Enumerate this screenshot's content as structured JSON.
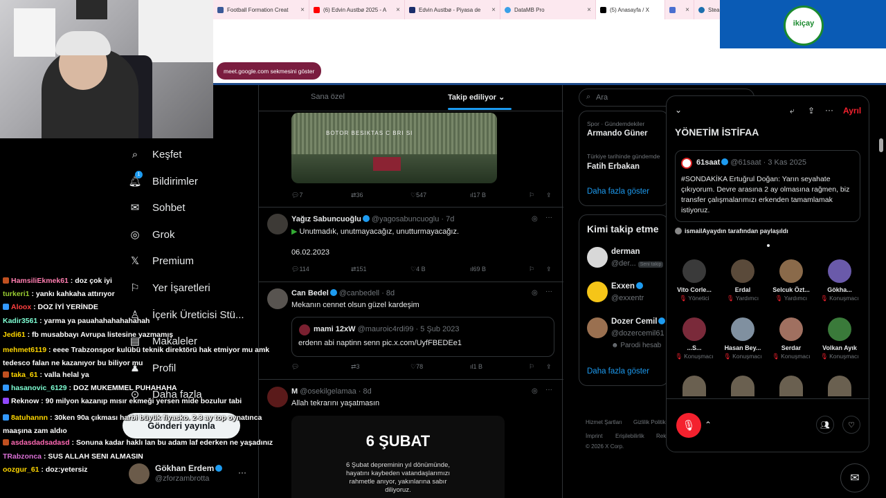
{
  "browser": {
    "tabs": [
      {
        "label": "Football Formation Creat",
        "color": "#3b5998"
      },
      {
        "label": "(6) Edvin Austbø 2025 - A",
        "color": "#ff0000"
      },
      {
        "label": "Edvin Austbø - Piyasa de",
        "color": "#1a2d6b"
      },
      {
        "label": "DataMB Pro",
        "color": "#3aa0e8"
      },
      {
        "label": "(5) Anasayfa / X",
        "color": "#000000"
      },
      {
        "label": "",
        "color": "#4a6fd0"
      },
      {
        "label": "Steam",
        "color": "#1b6fae"
      }
    ],
    "notification_pill": "meet.google.com sekmesini göster"
  },
  "sponsor": {
    "logo_text": "ikiçay"
  },
  "nav": {
    "items": [
      {
        "icon": "search-icon",
        "label": "Keşfet"
      },
      {
        "icon": "bell-icon",
        "label": "Bildirimler"
      },
      {
        "icon": "mail-icon",
        "label": "Sohbet"
      },
      {
        "icon": "grok-icon",
        "label": "Grok"
      },
      {
        "icon": "x-logo-icon",
        "label": "Premium"
      },
      {
        "icon": "bookmark-icon",
        "label": "Yer İşaretleri"
      },
      {
        "icon": "creator-icon",
        "label": "İçerik Üreticisi Stü..."
      },
      {
        "icon": "lists-icon",
        "label": "Makaleler"
      },
      {
        "icon": "person-icon",
        "label": "Profil"
      },
      {
        "icon": "more-icon",
        "label": "Daha fazla"
      }
    ],
    "notification_badge": "1",
    "post_button": "Gönderi yayınla",
    "account": {
      "name": "Gökhan Erdem",
      "handle": "@zforzambrotta"
    }
  },
  "feed": {
    "tabs": {
      "for_you": "Sana özel",
      "following": "Takip ediliyor"
    },
    "tweet0": {
      "media_text": "BOTOR BESIKTAS C BRI SI",
      "replies": "7",
      "retweets": "36",
      "likes": "547",
      "views": "17 B"
    },
    "tweet1": {
      "name": "Yağız Sabuncuoğlu",
      "handle": "@yagosabuncuoglu",
      "time": "7d",
      "text": "Unutmadık, unutmayacağız, unutturmayacağız.",
      "text2": "06.02.2023",
      "replies": "114",
      "retweets": "151",
      "likes": "4 B",
      "views": "69 B"
    },
    "tweet2": {
      "name": "Can Bedel",
      "handle": "@canbedell",
      "time": "8d",
      "text": "Mekanın cennet olsun güzel kardeşim",
      "quote_name": "mami 12xW",
      "quote_handle": "@mauroic4rdi99",
      "quote_time": "5 Şub 2023",
      "quote_text": "erdenn abi naptinn senn pic.x.com/UyfFBEDEe1",
      "replies": "",
      "retweets": "3",
      "likes": "78",
      "views": "1 B"
    },
    "tweet3": {
      "name": "M",
      "handle": "@osekilgelamaa",
      "time": "8d",
      "text": "Allah tekrarını yaşatmasın",
      "card_title": "6 ŞUBAT",
      "card_text": "6 Şubat depreminin yıl dönümünde,\nhayatını kaybeden vatandaşlarımızı\nrahmetle anıyor, yakınlarına sabır\ndiliyoruz."
    }
  },
  "right": {
    "search_placeholder": "Ara",
    "trends": [
      {
        "context": "Spor · Gündemdekiler",
        "name": "Armando Güner"
      },
      {
        "context": "Türkiye tarihinde gündemde",
        "name": "Fatih Erbakan"
      }
    ],
    "trends_more": "Daha fazla göster",
    "who_title": "Kimi takip etme",
    "who": [
      {
        "name": "derman",
        "handle": "@der...",
        "badge": "Seni takip"
      },
      {
        "name": "Exxen",
        "handle": "@exxentr",
        "badge": ""
      },
      {
        "name": "Dozer Cemil",
        "handle": "@dozercemil61",
        "badge": "Parodi hesab"
      }
    ],
    "who_more": "Daha fazla göster",
    "footer": [
      "Hizmet Şartları",
      "Gizlilik Politik",
      "İmprint",
      "Erişilebilirlik",
      "Rek",
      "© 2026 X Corp."
    ]
  },
  "space": {
    "leave": "Ayrıl",
    "title": "YÖNETİM İSTİFAA",
    "pinned": {
      "name": "61saat",
      "handle": "@61saat",
      "date": "3 Kas 2025",
      "text": "#SONDAKİKA Ertuğrul Doğan: Yarın seyahate çıkıyorum. Devre arasına 2 ay olmasına rağmen, biz transfer çalışmalarımızı erkenden tamamlamak istiyoruz."
    },
    "shared_by": "ismailAyaydın tarafından paylaşıldı",
    "participants": [
      {
        "name": "Vito Corle...",
        "role": "Yönetici",
        "color": "#3a3a3a"
      },
      {
        "name": "Erdal",
        "role": "Yardımcı",
        "color": "#5a4a3a"
      },
      {
        "name": "Selcuk Özt...",
        "role": "Yardımcı",
        "color": "#8a6a4a"
      },
      {
        "name": "Gökha...",
        "role": "Konuşmacı",
        "color": "#6a5aaa"
      },
      {
        "name": "...S...",
        "role": "Konuşmacı",
        "color": "#7a2a3a"
      },
      {
        "name": "Hasan Bey...",
        "role": "Konuşmacı",
        "color": "#8090a0"
      },
      {
        "name": "Serdar",
        "role": "Konuşmacı",
        "color": "#a07060"
      },
      {
        "name": "Volkan Ayık",
        "role": "Konuşmacı",
        "color": "#3a7a3a"
      }
    ]
  },
  "chat": [
    {
      "user": "HamsiliEkmek61",
      "color": "#ff7eb0",
      "msg": "doz çok iyi",
      "badge": "#c05020"
    },
    {
      "user": "turkeri1",
      "color": "#9acd32",
      "msg": "yankı kahkaha attırıyor",
      "badge": ""
    },
    {
      "user": "Aloox",
      "color": "#ff4040",
      "msg": "DOZ İYİ YERİNDE",
      "badge": "#3399ff"
    },
    {
      "user": "Kadir3561",
      "color": "#7fffd4",
      "msg": "yarma ya pauahahahahahahah",
      "badge": ""
    },
    {
      "user": "Jedi61",
      "color": "#ffd700",
      "msg": "fb musabbayı Avrupa listesine yazmamış",
      "badge": ""
    },
    {
      "user": "mehmet6119",
      "color": "#ffd700",
      "msg": "eeee Trabzonspor kulübü teknik direktörü hak etmiyor mu amk tedesco falan ne kazanıyor bu biliyor mu",
      "badge": ""
    },
    {
      "user": "taka_61",
      "color": "#ffd700",
      "msg": "valla helal ya",
      "badge": "#c05020"
    },
    {
      "user": "hasanovic_6129",
      "color": "#7fffd4",
      "msg": "DOZ MUKEMMEL PUHAHAHA",
      "badge": "#3399ff"
    },
    {
      "user": "Reknow",
      "color": "#ffffff",
      "msg": "90 milyon kazanıp mısır ekmeği yersen mide bozulur tabi",
      "badge": "#9147ff"
    },
    {
      "user": "8atuhannn",
      "color": "#ffd700",
      "msg": "30ken 90a çıkması harbi büyük fiyasko. 2-3 ay top oynatınca maaşına zam aldıo",
      "badge": "#3399ff"
    },
    {
      "user": "asdasdadsadasd",
      "color": "#ff69b4",
      "msg": "Sonuna kadar haklı lan bu adam laf ederken ne yaşadınız",
      "badge": "#c05020"
    },
    {
      "user": "TRabzonca",
      "color": "#da70d6",
      "msg": "SUS ALLAH SENI ALMASIN",
      "badge": ""
    },
    {
      "user": "oozgur_61",
      "color": "#ffd700",
      "msg": "doz:yetersiz",
      "badge": ""
    }
  ]
}
